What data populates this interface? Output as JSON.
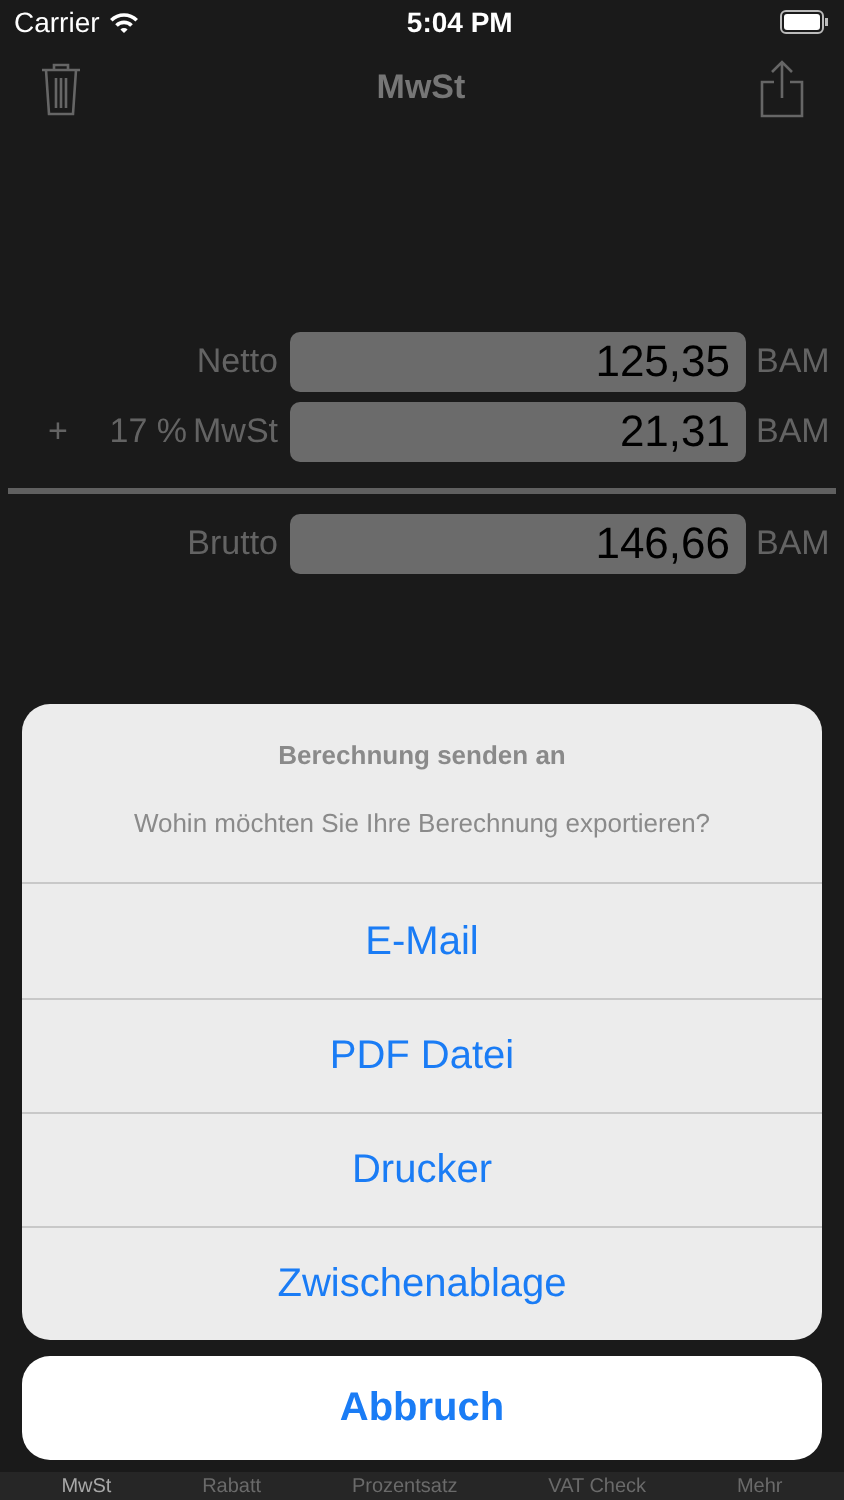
{
  "status_bar": {
    "carrier": "Carrier",
    "time": "5:04 PM"
  },
  "nav_bar": {
    "title": "MwSt"
  },
  "calculation": {
    "rows": [
      {
        "kind": "plain",
        "label": "Netto",
        "value": "125,35",
        "currency": "BAM"
      },
      {
        "kind": "rate",
        "sign": "+",
        "rate": "17 %",
        "label": "MwSt",
        "value": "21,31",
        "currency": "BAM"
      },
      {
        "kind": "total",
        "label": "Brutto",
        "value": "146,66",
        "currency": "BAM"
      }
    ]
  },
  "action_sheet": {
    "title": "Berechnung senden an",
    "message": "Wohin möchten Sie Ihre Berechnung exportieren?",
    "actions": [
      "E-Mail",
      "PDF Datei",
      "Drucker",
      "Zwischenablage"
    ],
    "cancel": "Abbruch"
  },
  "tab_bar": [
    {
      "label": "MwSt",
      "selected": true
    },
    {
      "label": "Rabatt",
      "selected": false
    },
    {
      "label": "Prozentsatz",
      "selected": false
    },
    {
      "label": "VAT Check",
      "selected": false
    },
    {
      "label": "Mehr",
      "selected": false
    }
  ]
}
